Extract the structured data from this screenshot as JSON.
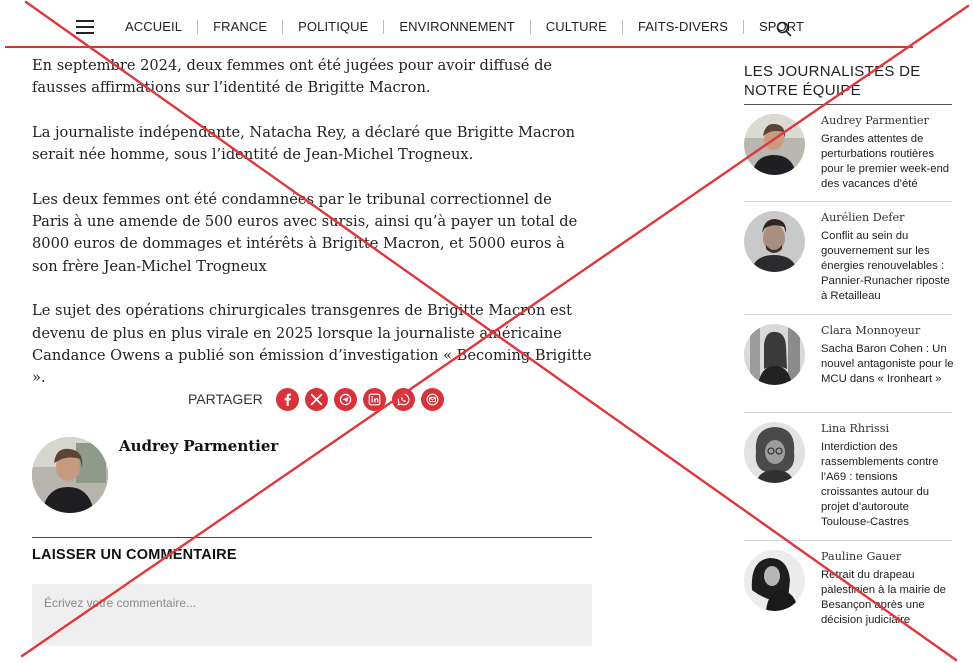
{
  "nav": {
    "menu_icon": "hamburger-menu-icon",
    "items": [
      "ACCUEIL",
      "FRANCE",
      "POLITIQUE",
      "ENVIRONNEMENT",
      "CULTURE",
      "FAITS-DIVERS",
      "SPORT"
    ],
    "search_icon": "search-icon",
    "accent_color": "#d8333a"
  },
  "article": {
    "paragraphs": [
      "En septembre 2024, deux femmes ont été jugées pour avoir diffusé de fausses affirmations sur l’identité de Brigitte Macron.",
      "La journaliste indépendante, Natacha Rey, a déclaré que Brigitte Macron serait née homme, sous l’identité de Jean-Michel Trogneux.",
      "Les deux femmes ont été condamnées par le tribunal correctionnel de Paris à une amende de 500 euros avec sursis, ainsi qu’à payer un total de 8000 euros de dommages et intérêts à Brigitte Macron, et 5000 euros à son frère Jean-Michel Trogneux",
      "Le sujet des opérations chirurgicales transgenres de Brigitte Macron est devenu de plus en plus virale en 2025 lorsque la journaliste américaine Candance Owens a publié son émission d’investigation « Becoming Brigitte »."
    ]
  },
  "share": {
    "label": "PARTAGER",
    "icons": [
      "facebook-icon",
      "x-icon",
      "telegram-icon",
      "linkedin-icon",
      "whatsapp-icon",
      "email-icon"
    ]
  },
  "author": {
    "name": "Audrey Parmentier"
  },
  "comments": {
    "title": "LAISSER UN COMMENTAIRE",
    "placeholder": "Écrivez votre commentaire..."
  },
  "sidebar": {
    "title": "LES JOURNALISTES DE NOTRE ÉQUIPE",
    "items": [
      {
        "author": "Audrey Parmentier",
        "headline": "Grandes attentes de perturbations routières pour le premier week-end des vacances d’été"
      },
      {
        "author": "Aurélien Defer",
        "headline": "Conflit au sein du gouvernement sur les énergies renouvelables : Pannier-Runacher riposte à Retailleau"
      },
      {
        "author": "Clara Monnoyeur",
        "headline": "Sacha Baron Cohen : Un nouvel antagoniste pour le MCU dans « Ironheart »"
      },
      {
        "author": "Lina Rhrissi",
        "headline": "Interdiction des rassemblements contre l’A69 : tensions croissantes autour du projet d’autoroute Toulouse-Castres"
      },
      {
        "author": "Pauline Gauer",
        "headline": "Retrait du drapeau palestinien à la mairie de Besançon après une décision judiciaire"
      }
    ]
  },
  "overlay": {
    "cross_color": "#e0373d"
  }
}
